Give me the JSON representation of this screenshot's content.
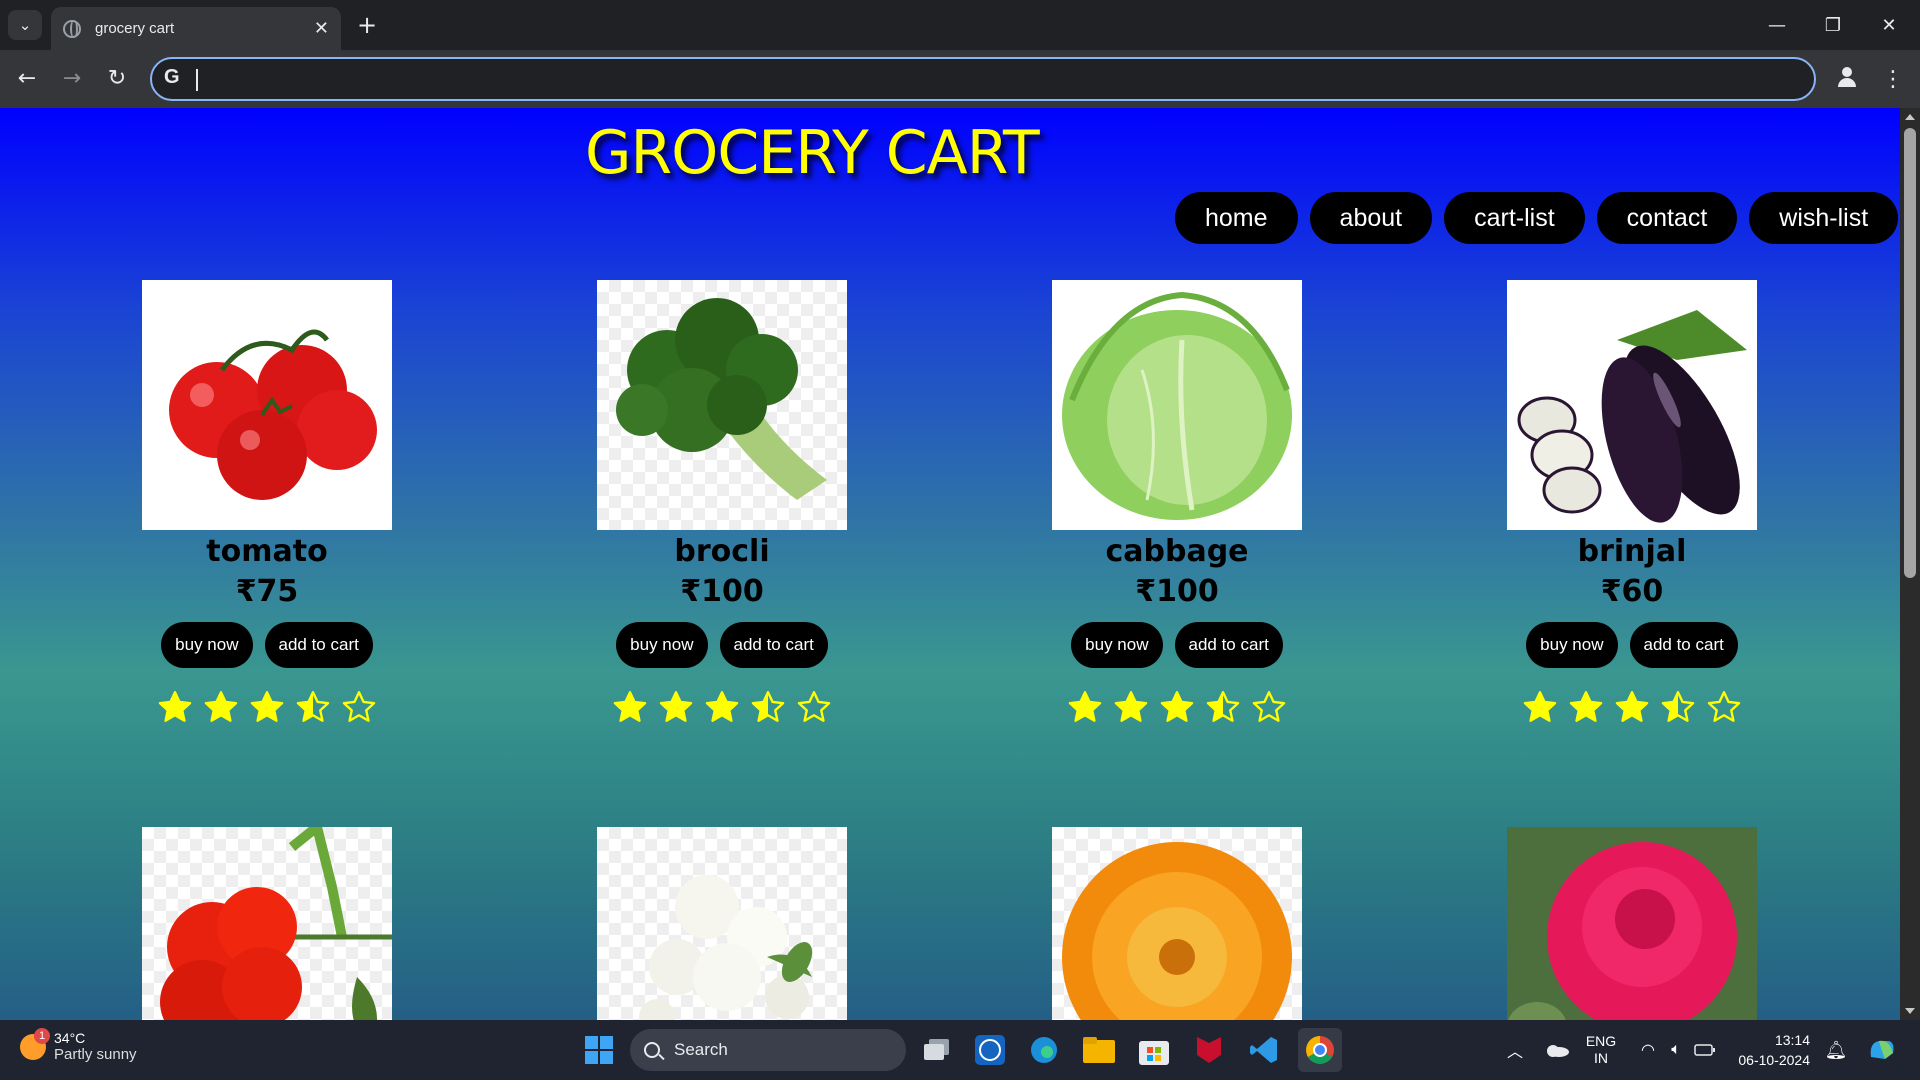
{
  "browser": {
    "tab_title": "grocery cart",
    "address": "",
    "colors": {
      "frame": "#202124",
      "toolbar": "#35363a",
      "focus": "#8ab4f8"
    }
  },
  "site": {
    "title": "GROCERY CART",
    "nav": [
      "home",
      "about",
      "cart-list",
      "contact",
      "wish-list"
    ],
    "colors": {
      "title": "#ffff00",
      "pill": "#000000",
      "star": "#ffff00",
      "bg_top": "#0000ff",
      "bg_mid": "#3a978f"
    }
  },
  "products": [
    {
      "name": "tomato",
      "price": "₹75",
      "buy_label": "buy now",
      "cart_label": "add to cart",
      "rating": 3.5,
      "image": "tomato"
    },
    {
      "name": "brocli",
      "price": "₹100",
      "buy_label": "buy now",
      "cart_label": "add to cart",
      "rating": 3.5,
      "image": "broccoli"
    },
    {
      "name": "cabbage",
      "price": "₹100",
      "buy_label": "buy now",
      "cart_label": "add to cart",
      "rating": 3.5,
      "image": "cabbage"
    },
    {
      "name": "brinjal",
      "price": "₹60",
      "buy_label": "buy now",
      "cart_label": "add to cart",
      "rating": 3.5,
      "image": "brinjal"
    }
  ],
  "flowers": [
    {
      "image": "hibiscus"
    },
    {
      "image": "jasmine"
    },
    {
      "image": "marigold"
    },
    {
      "image": "rose"
    }
  ],
  "taskbar": {
    "weather_temp": "34°C",
    "weather_desc": "Partly sunny",
    "weather_badge": "1",
    "search_label": "Search",
    "lang_top": "ENG",
    "lang_bottom": "IN",
    "time": "13:14",
    "date": "06-10-2024"
  }
}
